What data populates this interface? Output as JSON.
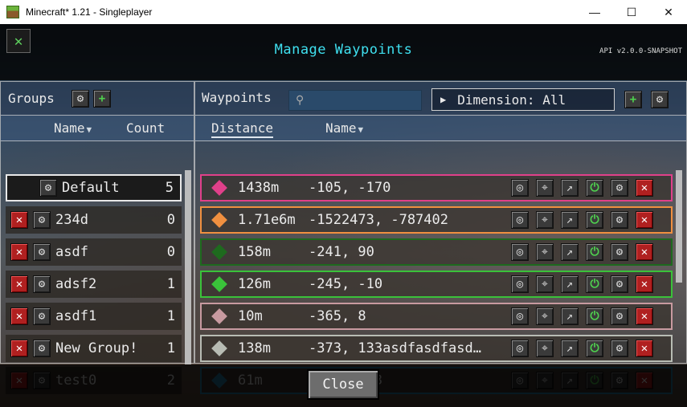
{
  "window": {
    "title": "Minecraft* 1.21 - Singleplayer",
    "minimize": "—",
    "maximize": "☐",
    "close": "✕"
  },
  "screen": {
    "title": "Manage Waypoints",
    "api_version": "API v2.0.0-SNAPSHOT"
  },
  "groups": {
    "label": "Groups",
    "col_name": "Name",
    "col_count": "Count",
    "items": [
      {
        "name": "Default",
        "count": "5"
      },
      {
        "name": "234d",
        "count": "0"
      },
      {
        "name": "asdf",
        "count": "0"
      },
      {
        "name": "adsf2",
        "count": "1"
      },
      {
        "name": "asdf1",
        "count": "1"
      },
      {
        "name": "New Group!",
        "count": "1"
      },
      {
        "name": "test0",
        "count": "2"
      }
    ]
  },
  "waypoints": {
    "label": "Waypoints",
    "search_placeholder": "",
    "dimension_filter": "Dimension: All",
    "col_distance": "Distance",
    "col_name": "Name",
    "items": [
      {
        "distance": "1438m",
        "coords": "-105, -170",
        "color": "#e0408a"
      },
      {
        "distance": "1.71e6m",
        "coords": "-1522473, -787402",
        "color": "#f09040"
      },
      {
        "distance": "158m",
        "coords": "-241, 90",
        "color": "#1e6a1e"
      },
      {
        "distance": "126m",
        "coords": "-245, -10",
        "color": "#3ac23a"
      },
      {
        "distance": "10m",
        "coords": "-365, 8",
        "color": "#c89aa0"
      },
      {
        "distance": "138m",
        "coords": "-373, 133asdfasdfasd…",
        "color": "#b8bcb4"
      },
      {
        "distance": "61m",
        "coords": "-420, -33",
        "color": "#2a8ab8"
      }
    ]
  },
  "footer": {
    "close_label": "Close"
  }
}
